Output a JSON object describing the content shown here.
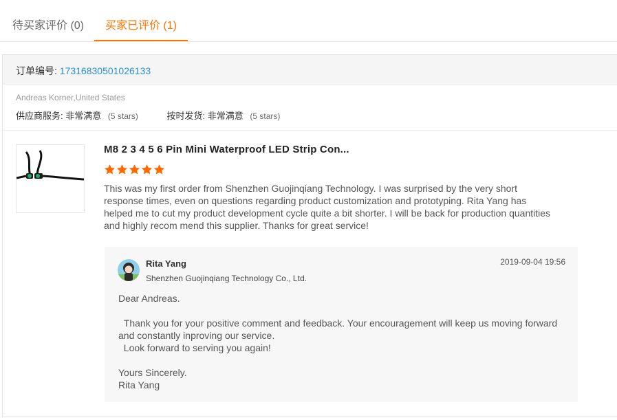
{
  "tabs": [
    {
      "label": "待买家评价 (0)"
    },
    {
      "label": "买家已评价 (1)"
    }
  ],
  "order": {
    "label": "订单编号:",
    "number": "17316830501026133"
  },
  "buyer": {
    "name_location": "Andreas Korner,United States"
  },
  "ratings": [
    {
      "label": "供应商服务:",
      "value": "非常满意",
      "stars_text": "(5 stars)"
    },
    {
      "label": "按时发货:",
      "value": "非常满意",
      "stars_text": "(5 stars)"
    }
  ],
  "product": {
    "title": "M8 2 3 4 5 6 Pin Mini Waterproof LED Strip Con...",
    "rating": 5,
    "star_color": "#ff6a00",
    "review": "This was my first order from Shenzhen Guojinqiang Technology. I was surprised by the very short response times, even on questions regarding product customization and prototyping. Rita Yang has helped me to cut my product development cycle quite a bit shorter. I will be back for production quantities and highly recom mend this supplier. Thanks for great service!"
  },
  "reply": {
    "name": "Rita Yang",
    "company": "Shenzhen Guojinqiang Technology Co., Ltd.",
    "time": "2019-09-04 19:56",
    "lines": [
      "Dear Andreas.",
      " ",
      "  Thank you for your positive comment and feedback. Your encouragement will keep us moving forward and constantly inproving our service.",
      "  Look forward to serving you again!",
      " ",
      "Yours Sincerely.",
      "Rita Yang"
    ]
  },
  "colors": {
    "accent": "#ff7300",
    "link": "#2a8fd6"
  }
}
